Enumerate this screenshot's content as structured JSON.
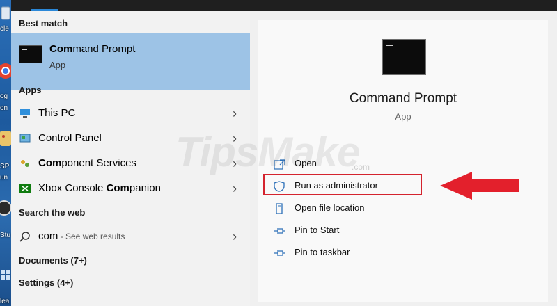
{
  "desktop": {
    "icons": [
      {
        "name": "recycle-bin",
        "label": "cle"
      },
      {
        "name": "chrome",
        "label": "og"
      },
      {
        "name": "folder",
        "label": "on"
      },
      {
        "name": "paint-app",
        "label": "SP"
      },
      {
        "name": "app-unknown",
        "label": "un"
      },
      {
        "name": "obs",
        "label": "Stu"
      },
      {
        "name": "app-grid",
        "label": "lea"
      }
    ]
  },
  "best_match": {
    "header": "Best match",
    "title_bold": "Com",
    "title_rest": "mand Prompt",
    "subtitle": "App",
    "icon": "cmd-icon"
  },
  "apps": {
    "header": "Apps",
    "items": [
      {
        "icon": "this-pc-icon",
        "pre": "This PC",
        "bold": "",
        "post": ""
      },
      {
        "icon": "control-panel-icon",
        "pre": "Control Panel",
        "bold": "",
        "post": ""
      },
      {
        "icon": "component-services-icon",
        "pre": "",
        "bold": "Com",
        "post": "ponent Services"
      },
      {
        "icon": "xbox-icon",
        "pre": "Xbox Console ",
        "bold": "Com",
        "post": "panion"
      }
    ]
  },
  "web": {
    "header": "Search the web",
    "query": "com",
    "hint": " - See web results",
    "icon": "search-icon"
  },
  "documents": {
    "label": "Documents (7+)"
  },
  "settings": {
    "label": "Settings (4+)"
  },
  "detail": {
    "title": "Command Prompt",
    "subtitle": "App",
    "actions": [
      {
        "icon": "open-icon",
        "label": "Open"
      },
      {
        "icon": "shield-icon",
        "label": "Run as administrator"
      },
      {
        "icon": "file-location-icon",
        "label": "Open file location"
      },
      {
        "icon": "pin-icon",
        "label": "Pin to Start"
      },
      {
        "icon": "pin-icon",
        "label": "Pin to taskbar"
      }
    ]
  },
  "chevron": "›",
  "watermark": {
    "main": "TipsMake",
    "sub": ".com"
  },
  "colors": {
    "selection": "#9dc3e6",
    "accent": "#2b88d8",
    "annotation_red": "#d4232e"
  }
}
